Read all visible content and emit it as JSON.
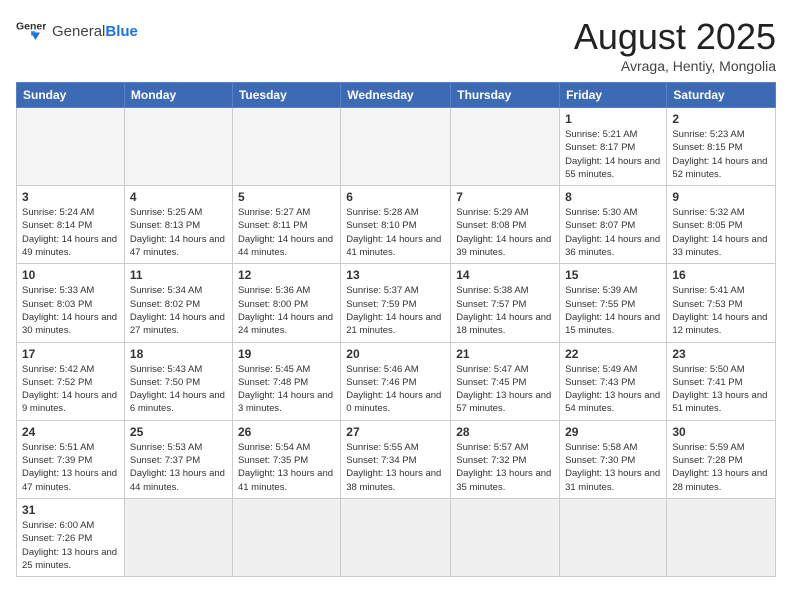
{
  "header": {
    "logo_general": "General",
    "logo_blue": "Blue",
    "title": "August 2025",
    "subtitle": "Avraga, Hentiy, Mongolia"
  },
  "weekdays": [
    "Sunday",
    "Monday",
    "Tuesday",
    "Wednesday",
    "Thursday",
    "Friday",
    "Saturday"
  ],
  "weeks": [
    [
      {
        "day": "",
        "info": ""
      },
      {
        "day": "",
        "info": ""
      },
      {
        "day": "",
        "info": ""
      },
      {
        "day": "",
        "info": ""
      },
      {
        "day": "",
        "info": ""
      },
      {
        "day": "1",
        "info": "Sunrise: 5:21 AM\nSunset: 8:17 PM\nDaylight: 14 hours and 55 minutes."
      },
      {
        "day": "2",
        "info": "Sunrise: 5:23 AM\nSunset: 8:15 PM\nDaylight: 14 hours and 52 minutes."
      }
    ],
    [
      {
        "day": "3",
        "info": "Sunrise: 5:24 AM\nSunset: 8:14 PM\nDaylight: 14 hours and 49 minutes."
      },
      {
        "day": "4",
        "info": "Sunrise: 5:25 AM\nSunset: 8:13 PM\nDaylight: 14 hours and 47 minutes."
      },
      {
        "day": "5",
        "info": "Sunrise: 5:27 AM\nSunset: 8:11 PM\nDaylight: 14 hours and 44 minutes."
      },
      {
        "day": "6",
        "info": "Sunrise: 5:28 AM\nSunset: 8:10 PM\nDaylight: 14 hours and 41 minutes."
      },
      {
        "day": "7",
        "info": "Sunrise: 5:29 AM\nSunset: 8:08 PM\nDaylight: 14 hours and 39 minutes."
      },
      {
        "day": "8",
        "info": "Sunrise: 5:30 AM\nSunset: 8:07 PM\nDaylight: 14 hours and 36 minutes."
      },
      {
        "day": "9",
        "info": "Sunrise: 5:32 AM\nSunset: 8:05 PM\nDaylight: 14 hours and 33 minutes."
      }
    ],
    [
      {
        "day": "10",
        "info": "Sunrise: 5:33 AM\nSunset: 8:03 PM\nDaylight: 14 hours and 30 minutes."
      },
      {
        "day": "11",
        "info": "Sunrise: 5:34 AM\nSunset: 8:02 PM\nDaylight: 14 hours and 27 minutes."
      },
      {
        "day": "12",
        "info": "Sunrise: 5:36 AM\nSunset: 8:00 PM\nDaylight: 14 hours and 24 minutes."
      },
      {
        "day": "13",
        "info": "Sunrise: 5:37 AM\nSunset: 7:59 PM\nDaylight: 14 hours and 21 minutes."
      },
      {
        "day": "14",
        "info": "Sunrise: 5:38 AM\nSunset: 7:57 PM\nDaylight: 14 hours and 18 minutes."
      },
      {
        "day": "15",
        "info": "Sunrise: 5:39 AM\nSunset: 7:55 PM\nDaylight: 14 hours and 15 minutes."
      },
      {
        "day": "16",
        "info": "Sunrise: 5:41 AM\nSunset: 7:53 PM\nDaylight: 14 hours and 12 minutes."
      }
    ],
    [
      {
        "day": "17",
        "info": "Sunrise: 5:42 AM\nSunset: 7:52 PM\nDaylight: 14 hours and 9 minutes."
      },
      {
        "day": "18",
        "info": "Sunrise: 5:43 AM\nSunset: 7:50 PM\nDaylight: 14 hours and 6 minutes."
      },
      {
        "day": "19",
        "info": "Sunrise: 5:45 AM\nSunset: 7:48 PM\nDaylight: 14 hours and 3 minutes."
      },
      {
        "day": "20",
        "info": "Sunrise: 5:46 AM\nSunset: 7:46 PM\nDaylight: 14 hours and 0 minutes."
      },
      {
        "day": "21",
        "info": "Sunrise: 5:47 AM\nSunset: 7:45 PM\nDaylight: 13 hours and 57 minutes."
      },
      {
        "day": "22",
        "info": "Sunrise: 5:49 AM\nSunset: 7:43 PM\nDaylight: 13 hours and 54 minutes."
      },
      {
        "day": "23",
        "info": "Sunrise: 5:50 AM\nSunset: 7:41 PM\nDaylight: 13 hours and 51 minutes."
      }
    ],
    [
      {
        "day": "24",
        "info": "Sunrise: 5:51 AM\nSunset: 7:39 PM\nDaylight: 13 hours and 47 minutes."
      },
      {
        "day": "25",
        "info": "Sunrise: 5:53 AM\nSunset: 7:37 PM\nDaylight: 13 hours and 44 minutes."
      },
      {
        "day": "26",
        "info": "Sunrise: 5:54 AM\nSunset: 7:35 PM\nDaylight: 13 hours and 41 minutes."
      },
      {
        "day": "27",
        "info": "Sunrise: 5:55 AM\nSunset: 7:34 PM\nDaylight: 13 hours and 38 minutes."
      },
      {
        "day": "28",
        "info": "Sunrise: 5:57 AM\nSunset: 7:32 PM\nDaylight: 13 hours and 35 minutes."
      },
      {
        "day": "29",
        "info": "Sunrise: 5:58 AM\nSunset: 7:30 PM\nDaylight: 13 hours and 31 minutes."
      },
      {
        "day": "30",
        "info": "Sunrise: 5:59 AM\nSunset: 7:28 PM\nDaylight: 13 hours and 28 minutes."
      }
    ],
    [
      {
        "day": "31",
        "info": "Sunrise: 6:00 AM\nSunset: 7:26 PM\nDaylight: 13 hours and 25 minutes."
      },
      {
        "day": "",
        "info": ""
      },
      {
        "day": "",
        "info": ""
      },
      {
        "day": "",
        "info": ""
      },
      {
        "day": "",
        "info": ""
      },
      {
        "day": "",
        "info": ""
      },
      {
        "day": "",
        "info": ""
      }
    ]
  ]
}
